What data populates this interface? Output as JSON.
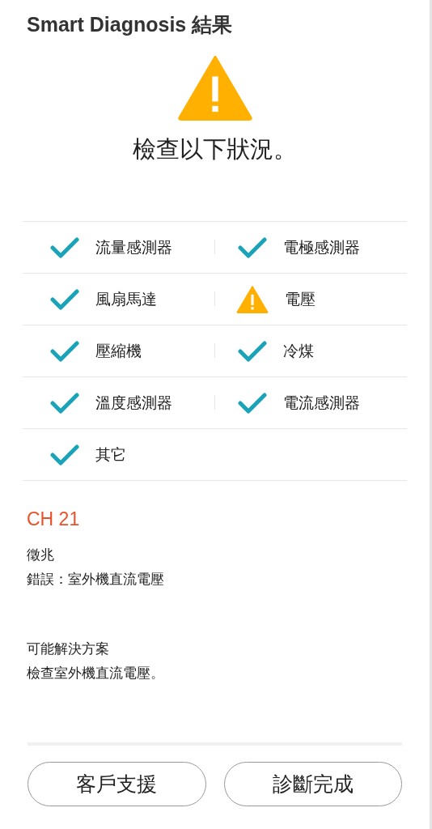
{
  "title": "Smart Diagnosis 結果",
  "summary": {
    "kind": "warning",
    "message": "檢查以下狀況。"
  },
  "checks": [
    {
      "label": "流量感測器",
      "kind": "ok"
    },
    {
      "label": "電極感測器",
      "kind": "ok"
    },
    {
      "label": "風扇馬達",
      "kind": "ok"
    },
    {
      "label": "電壓",
      "kind": "warning"
    },
    {
      "label": "壓縮機",
      "kind": "ok"
    },
    {
      "label": "冷煤",
      "kind": "ok"
    },
    {
      "label": "溫度感測器",
      "kind": "ok"
    },
    {
      "label": "電流感測器",
      "kind": "ok"
    },
    {
      "label": "其它",
      "kind": "ok"
    }
  ],
  "error": {
    "code": "CH 21",
    "symptom_heading": "徵兆",
    "symptom": "錯誤：室外機直流電壓",
    "solution_heading": "可能解決方案",
    "solution": "檢查室外機直流電壓。"
  },
  "buttons": [
    "客戶支援",
    "診斷完成"
  ]
}
